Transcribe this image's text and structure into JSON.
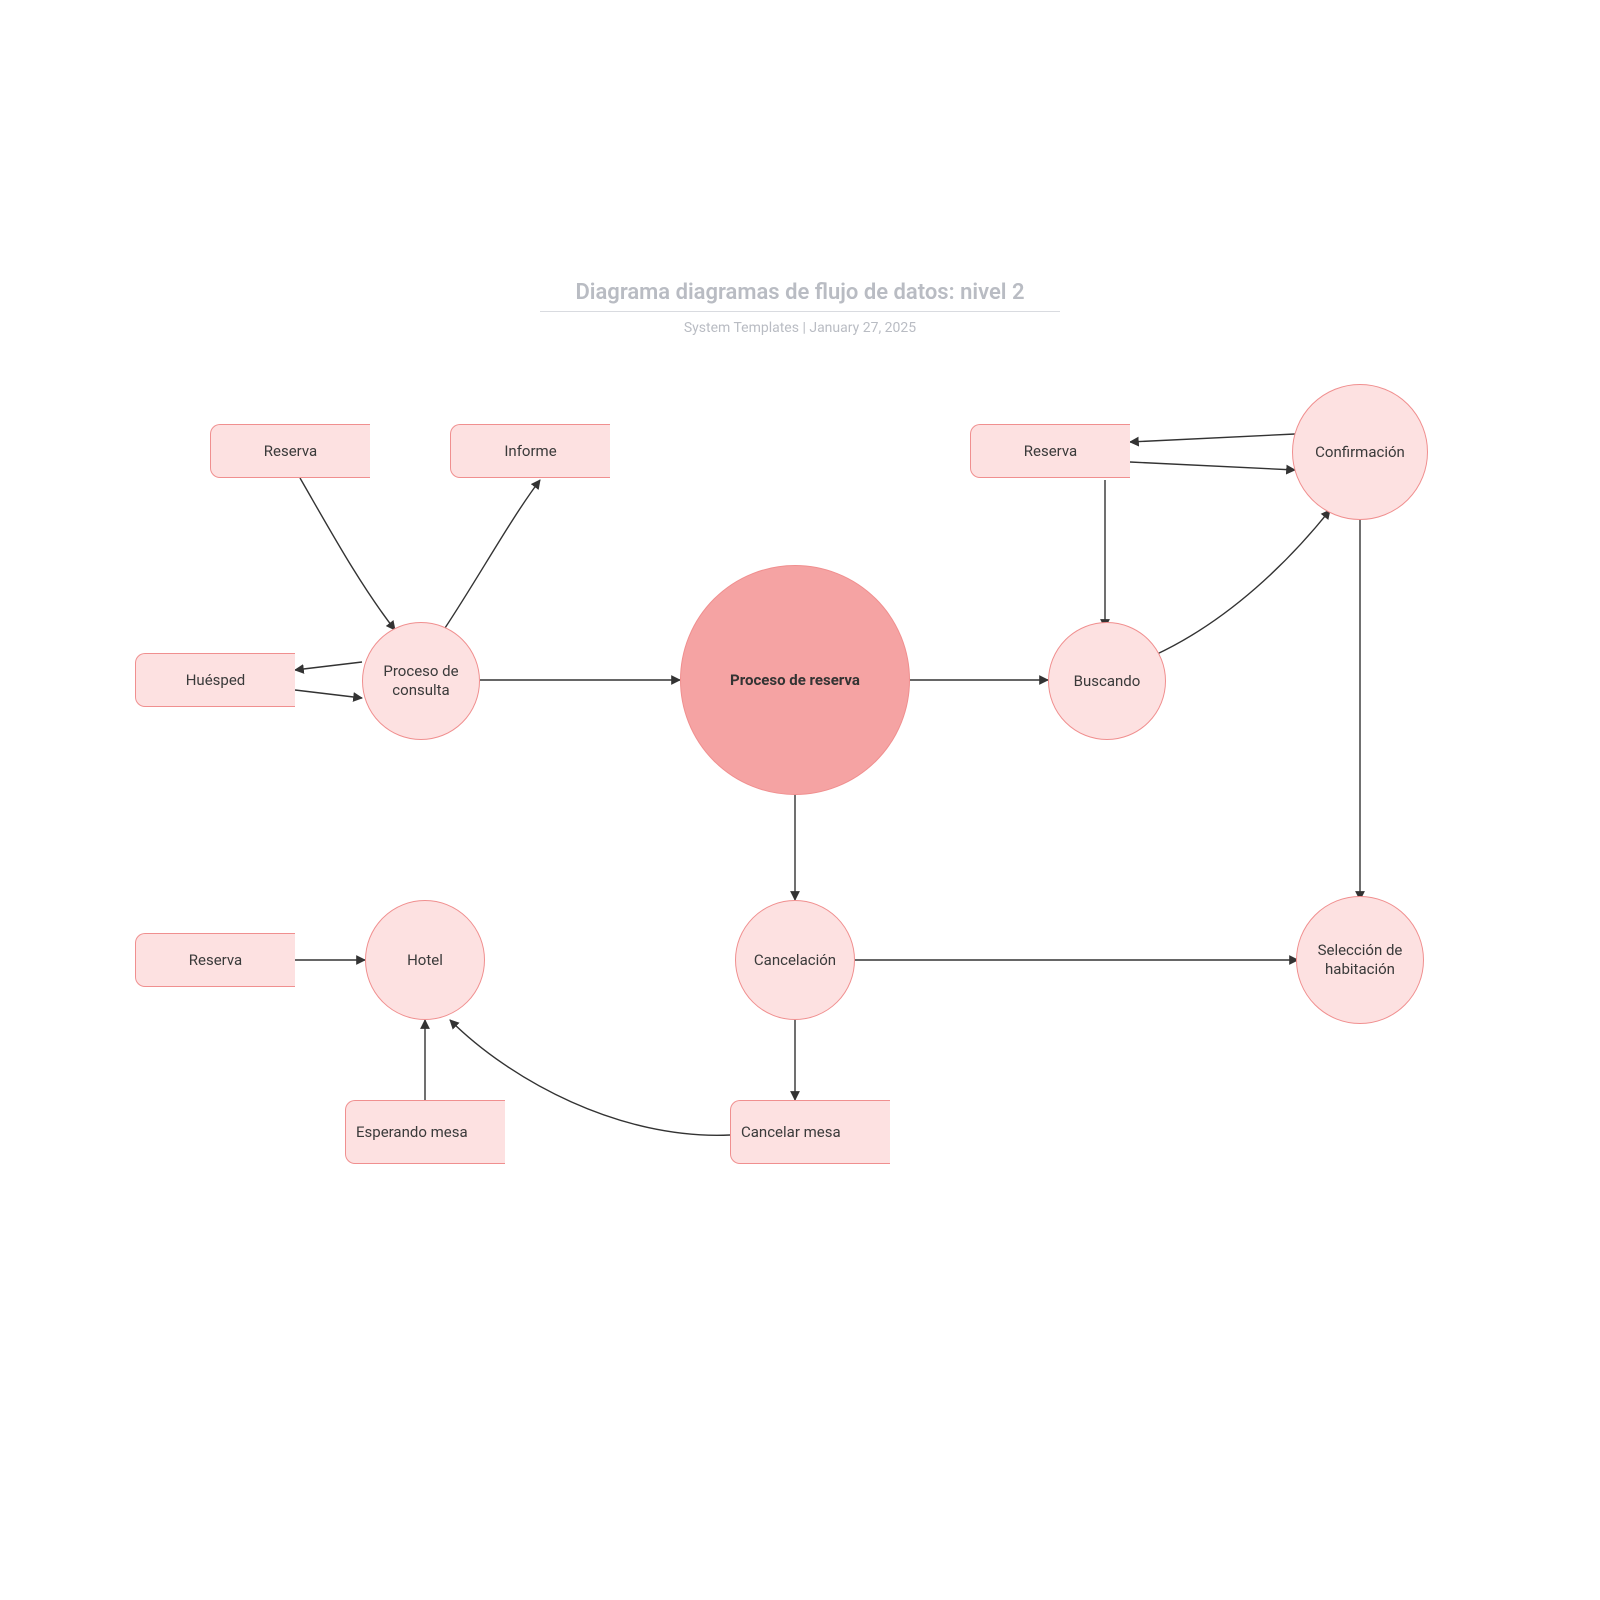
{
  "header": {
    "title": "Diagrama diagramas de flujo de datos: nivel 2",
    "subtitle_author": "System Templates",
    "subtitle_sep": "  |  ",
    "subtitle_date": "January 27, 2025"
  },
  "nodes": {
    "reserva_top_left": "Reserva",
    "informe": "Informe",
    "reserva_top_right": "Reserva",
    "huesped": "Huésped",
    "proceso_consulta": "Proceso de consulta",
    "proceso_reserva": "Proceso de reserva",
    "buscando": "Buscando",
    "confirmacion": "Confirmación",
    "reserva_bottom_left": "Reserva",
    "hotel": "Hotel",
    "cancelacion": "Cancelación",
    "seleccion_habitacion": "Selección de habitación",
    "esperando_mesa": "Esperando mesa",
    "cancelar_mesa": "Cancelar mesa"
  },
  "colors": {
    "node_fill": "#fde1e1",
    "node_stroke": "#f08f8f",
    "center_fill": "#f5a3a3",
    "edge": "#333333",
    "title": "#b9bcc3"
  }
}
